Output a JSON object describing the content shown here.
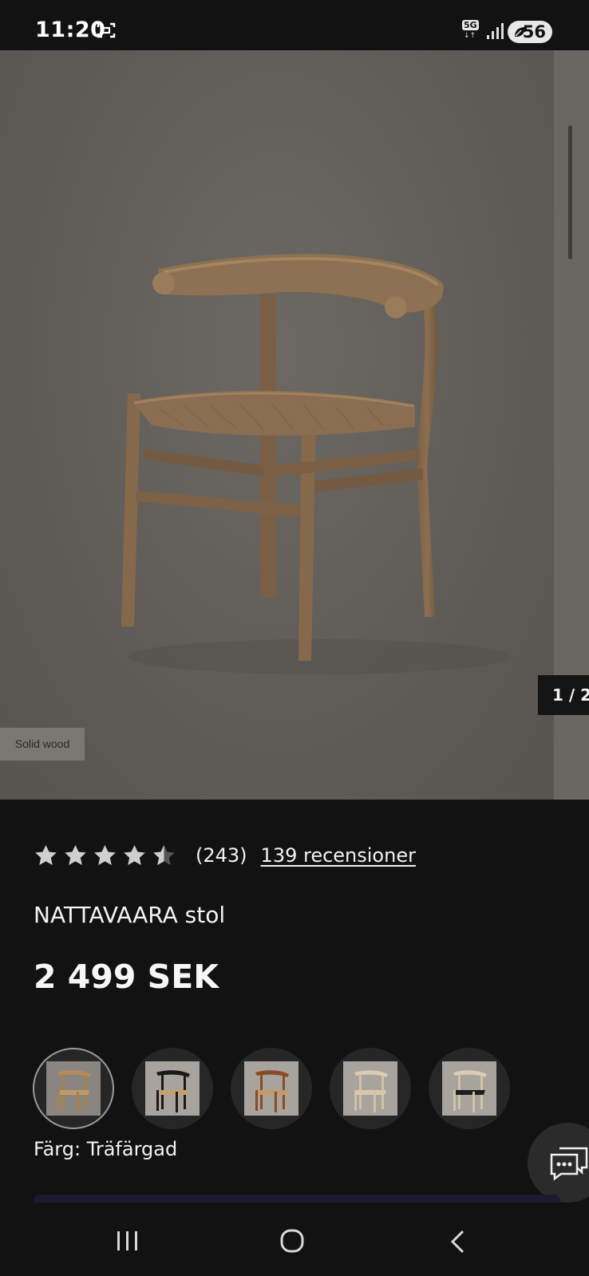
{
  "status_bar": {
    "time": "11:20",
    "network": "5G",
    "battery": "56",
    "icons": [
      "screenshot-icon",
      "signal-icon",
      "battery-saver-icon"
    ]
  },
  "gallery": {
    "material_tag": "Solid wood",
    "pager": "1 / 2"
  },
  "product": {
    "rating_stars": 4.5,
    "rating_count": "(243)",
    "reviews_link": "139 recensioner",
    "name": "NATTAVAARA stol",
    "price": "2 499 SEK",
    "color_label": "Färg: Träfärgad"
  },
  "swatches": [
    {
      "name": "natural-wood",
      "selected": true
    },
    {
      "name": "black-frame-natural-seat",
      "selected": false
    },
    {
      "name": "brown-wood",
      "selected": false
    },
    {
      "name": "light-wood",
      "selected": false
    },
    {
      "name": "light-wood-black-seat",
      "selected": false
    }
  ],
  "colors": {
    "background": "#121212",
    "text": "#f2f2f2",
    "star": "#cfcfcf"
  }
}
